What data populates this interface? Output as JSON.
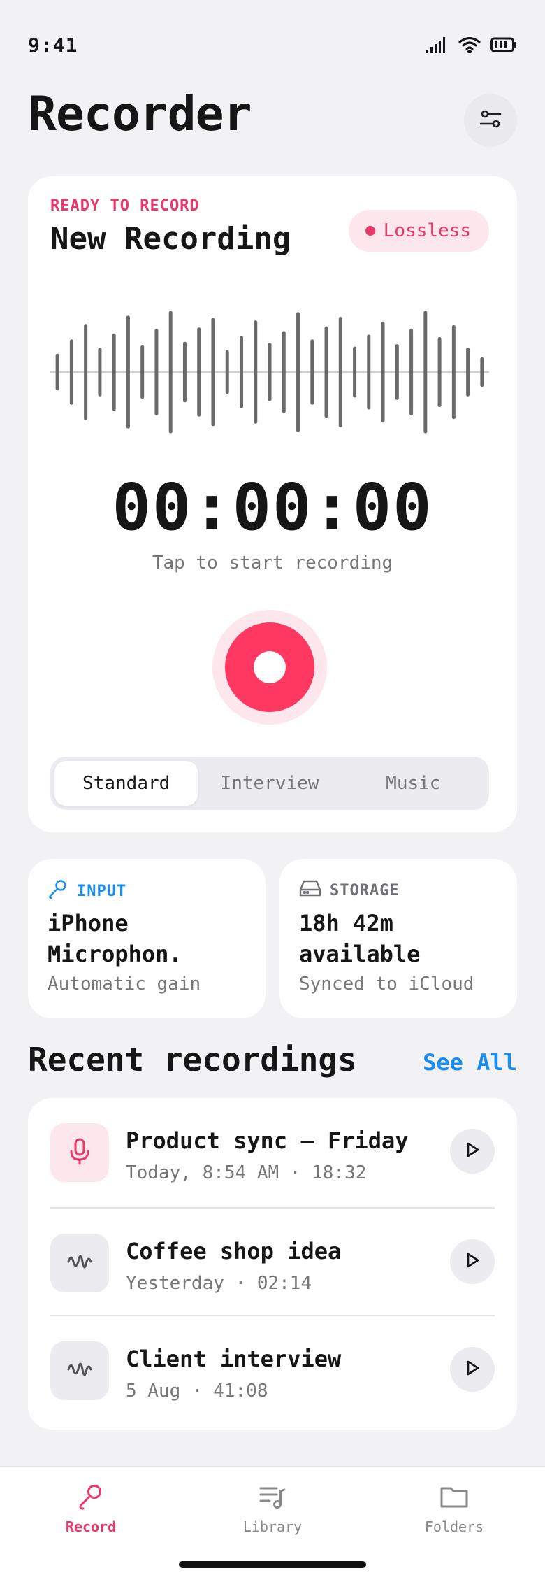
{
  "status_bar": {
    "time": "9:41"
  },
  "header": {
    "title": "Recorder"
  },
  "recorder": {
    "eyebrow": "READY TO RECORD",
    "title": "New Recording",
    "badge": "Lossless",
    "timer": "00:00:00",
    "hint": "Tap to start recording",
    "modes": [
      {
        "label": "Standard",
        "active": true
      },
      {
        "label": "Interview",
        "active": false
      },
      {
        "label": "Music",
        "active": false
      }
    ]
  },
  "info": {
    "input": {
      "label": "INPUT",
      "value": "iPhone Microphon.",
      "sub": "Automatic gain",
      "color": "#1a8cf0"
    },
    "storage": {
      "label": "STORAGE",
      "value": "18h 42m available",
      "sub": "Synced to iCloud",
      "color": "#6f6f75"
    }
  },
  "recent": {
    "title": "Recent recordings",
    "see_all": "See All",
    "items": [
      {
        "title": "Product sync — Friday",
        "sub": "Today, 8:54 AM · 18:32",
        "icon": "microphone-icon"
      },
      {
        "title": "Coffee shop idea",
        "sub": "Yesterday · 02:14",
        "icon": "waveform-icon"
      },
      {
        "title": "Client interview",
        "sub": "5 Aug · 41:08",
        "icon": "waveform-icon"
      }
    ]
  },
  "tabs": [
    {
      "label": "Record",
      "active": true,
      "icon": "record-mic-icon"
    },
    {
      "label": "Library",
      "active": false,
      "icon": "library-icon"
    },
    {
      "label": "Folders",
      "active": false,
      "icon": "folder-icon"
    }
  ],
  "colors": {
    "accent": "#ff3862",
    "accent_text": "#e9386a",
    "link": "#1a8cf0",
    "background": "#f2f2f5"
  },
  "waveform": {
    "levels": [
      0.28,
      0.52,
      0.78,
      0.38,
      0.62,
      0.92,
      0.42,
      0.7,
      1.0,
      0.48,
      0.72,
      0.88,
      0.34,
      0.58,
      0.84,
      0.46,
      0.66,
      0.98,
      0.52,
      0.74,
      0.9,
      0.4,
      0.6,
      0.82,
      0.44,
      0.7,
      1.0,
      0.56,
      0.76,
      0.38,
      0.22
    ]
  }
}
